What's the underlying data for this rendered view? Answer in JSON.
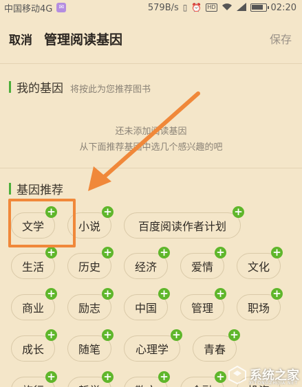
{
  "status_bar": {
    "carrier": "中国移动4G",
    "sim_badge": "✉",
    "net_speed": "579B/s",
    "hd": "HD",
    "time": "02:20"
  },
  "header": {
    "cancel": "取消",
    "title": "管理阅读基因",
    "save": "保存"
  },
  "my_genes": {
    "title": "我的基因",
    "subtitle": "将按此为您推荐图书",
    "empty_line1": "还未添加阅读基因",
    "empty_line2": "从下面推荐基因中选几个感兴趣的吧"
  },
  "recommend": {
    "title": "基因推荐",
    "tags": [
      "文学",
      "小说",
      "百度阅读作者计划",
      "生活",
      "历史",
      "经济",
      "爱情",
      "文化",
      "商业",
      "励志",
      "中国",
      "管理",
      "职场",
      "成长",
      "随笔",
      "心理学",
      "青春",
      "旅行",
      "哲学",
      "散文",
      "金融",
      "投资"
    ],
    "add_symbol": "+"
  },
  "watermark": {
    "text": "系统之家",
    "sub": "XITONGZHIJIA.NET"
  },
  "colors": {
    "background": "#f4e6c9",
    "accent_green": "#5fb62b",
    "annotation_orange": "#f0883a"
  }
}
